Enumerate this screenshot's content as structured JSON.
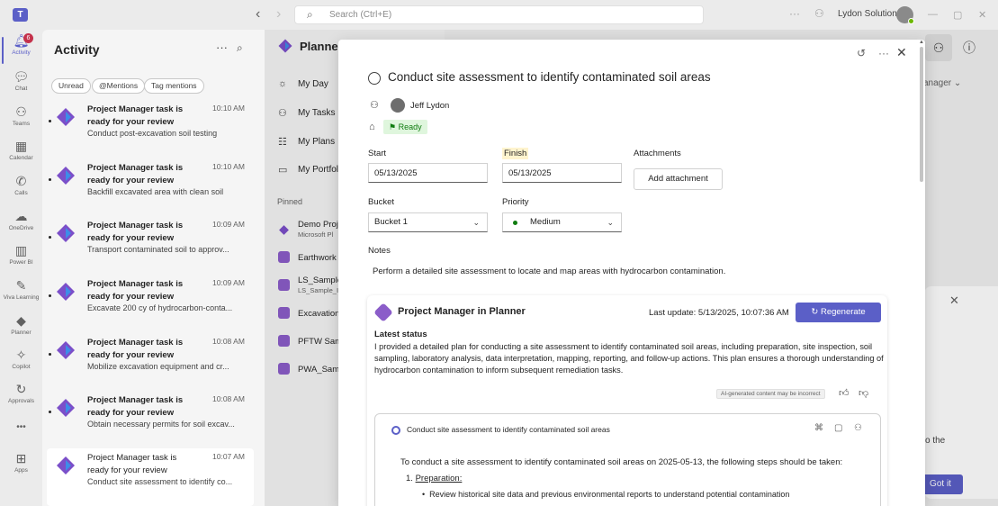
{
  "titlebar": {
    "search_placeholder": "Search (Ctrl+E)",
    "org_name": "Lydon Solutions",
    "back_glyph": "‹",
    "forward_glyph": "›"
  },
  "rail": {
    "items": [
      {
        "label": "Activity",
        "icon": "bell-icon",
        "badge": "6"
      },
      {
        "label": "Chat",
        "icon": "chat-icon"
      },
      {
        "label": "Teams",
        "icon": "teams-icon"
      },
      {
        "label": "Calendar",
        "icon": "calendar-icon"
      },
      {
        "label": "Calls",
        "icon": "phone-icon"
      },
      {
        "label": "OneDrive",
        "icon": "cloud-icon"
      },
      {
        "label": "Power BI",
        "icon": "powerbi-icon"
      },
      {
        "label": "Viva Learning",
        "icon": "learning-icon"
      },
      {
        "label": "Planner",
        "icon": "planner-icon"
      },
      {
        "label": "Copilot",
        "icon": "copilot-icon"
      },
      {
        "label": "Approvals",
        "icon": "approvals-icon"
      },
      {
        "label": "Apps",
        "icon": "apps-icon"
      }
    ],
    "more": "•••"
  },
  "activity": {
    "title": "Activity",
    "filters": [
      "Unread",
      "@Mentions",
      "Tag mentions"
    ],
    "items": [
      {
        "title": "Project Manager task is ready for your review",
        "time": "10:10 AM",
        "subtitle": "Conduct post-excavation soil testing"
      },
      {
        "title": "Project Manager task is ready for your review",
        "time": "10:10 AM",
        "subtitle": "Backfill excavated area with clean soil"
      },
      {
        "title": "Project Manager task is ready for your review",
        "time": "10:09 AM",
        "subtitle": "Transport contaminated soil to approv..."
      },
      {
        "title": "Project Manager task is ready for your review",
        "time": "10:09 AM",
        "subtitle": "Excavate 200 cy of hydrocarbon-conta..."
      },
      {
        "title": "Project Manager task is ready for your review",
        "time": "10:08 AM",
        "subtitle": "Mobilize excavation equipment and cr..."
      },
      {
        "title": "Project Manager task is ready for your review",
        "time": "10:08 AM",
        "subtitle": "Obtain necessary permits for soil excav..."
      },
      {
        "title": "Project Manager task is ready for your review",
        "time": "10:07 AM",
        "subtitle": "Conduct site assessment to identify co..."
      }
    ]
  },
  "planner": {
    "title": "Planner",
    "nav": [
      "My Day",
      "My Tasks",
      "My Plans",
      "My Portfol"
    ],
    "pinned_label": "Pinned",
    "plans": [
      {
        "name": "Demo Proj",
        "sub": "Microsoft Pl"
      },
      {
        "name": "Earthwork",
        "sub": ""
      },
      {
        "name": "LS_Sample",
        "sub": "LS_Sample_I"
      },
      {
        "name": "Excavation",
        "sub": ""
      },
      {
        "name": "PFTW Sam",
        "sub": ""
      },
      {
        "name": "PWA_Samp",
        "sub": ""
      }
    ],
    "manager_dropdown": "anager ⌄",
    "tip_text": "o the",
    "got_it": "Got it"
  },
  "task": {
    "title": "Conduct site assessment to identify contaminated soil areas",
    "assignee": "Jeff Lydon",
    "label": "Ready",
    "start_label": "Start",
    "start_value": "05/13/2025",
    "finish_label": "Finish",
    "finish_value": "05/13/2025",
    "attachments_label": "Attachments",
    "add_attachment": "Add attachment",
    "bucket_label": "Bucket",
    "bucket_value": "Bucket 1",
    "priority_label": "Priority",
    "priority_value": "Medium",
    "notes_label": "Notes",
    "notes_text": "Perform a detailed site assessment to locate and map areas with hydrocarbon contamination."
  },
  "ai": {
    "title": "Project Manager in Planner",
    "last_update": "Last update: 5/13/2025, 10:07:36 AM",
    "regenerate": "Regenerate",
    "latest_label": "Latest status",
    "latest_text": "I provided a detailed plan for conducting a site assessment to identify contaminated soil areas, including preparation, site inspection, soil sampling, laboratory analysis, data interpretation, mapping, reporting, and follow-up actions. This plan ensures a thorough understanding of hydrocarbon contamination to inform subsequent remediation tasks.",
    "disclaimer": "AI-generated content may be incorrect",
    "inner_title": "Conduct site assessment to identify contaminated soil areas",
    "inner_intro": "To conduct a site assessment to identify contaminated soil areas on 2025-05-13, the following steps should be taken:",
    "step1_num": "1.",
    "step1": "Preparation:",
    "bullet1": "Review historical site data and previous environmental reports to understand potential contamination"
  },
  "colors": {
    "accent": "#5b5fc7",
    "ready_bg": "#dff6dd",
    "ready_fg": "#107c10",
    "badge": "#c4314b"
  }
}
